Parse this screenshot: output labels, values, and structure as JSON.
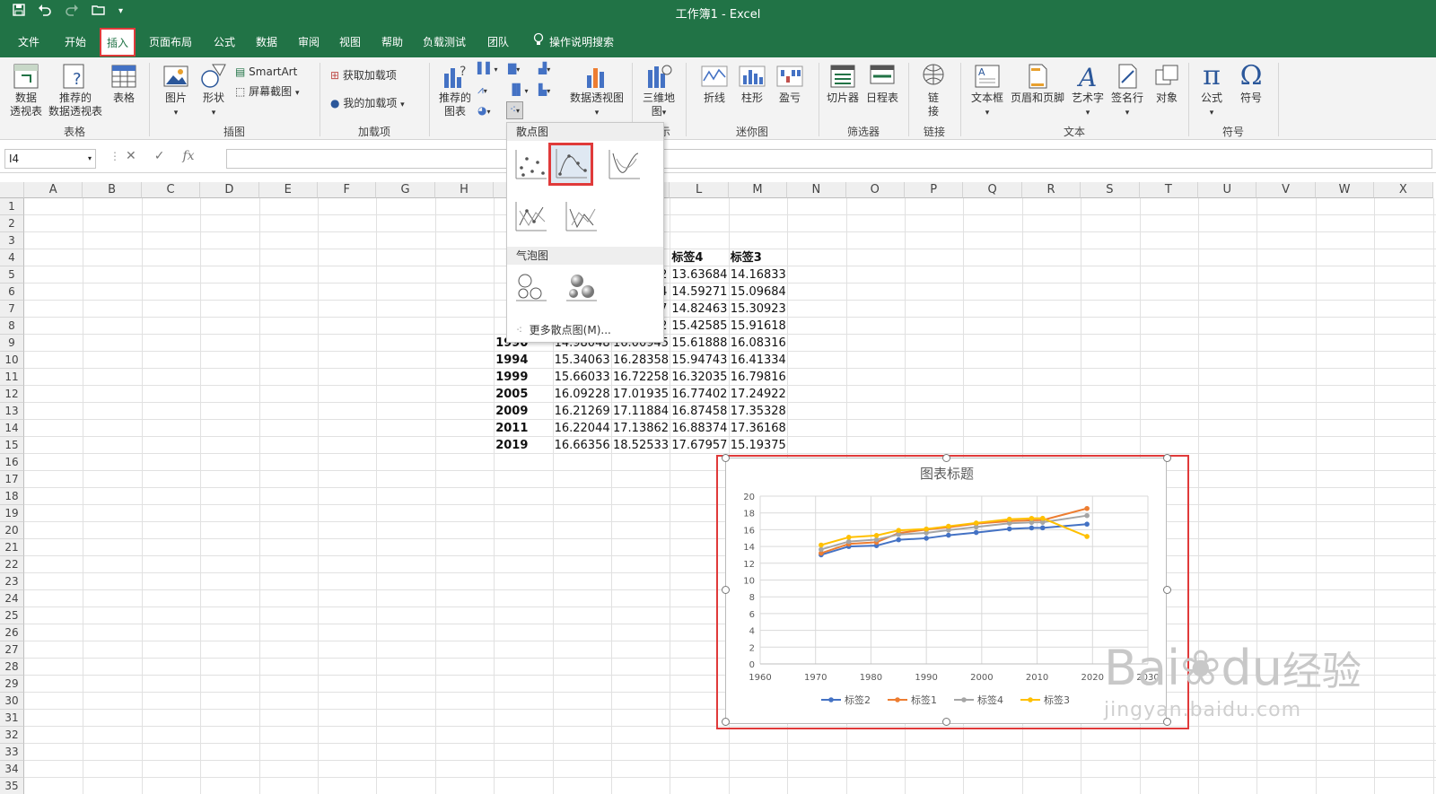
{
  "window": {
    "title": "工作簿1 - Excel",
    "accent": "#217346"
  },
  "qat": {
    "icons": [
      "save-icon",
      "undo-icon",
      "redo-icon",
      "open-icon",
      "customize-icon"
    ]
  },
  "tabs": [
    "文件",
    "开始",
    "插入",
    "页面布局",
    "公式",
    "数据",
    "审阅",
    "视图",
    "帮助",
    "负载测试",
    "团队"
  ],
  "active_tab": "插入",
  "tell_me": "操作说明搜索",
  "ribbon": {
    "groups": [
      "表格",
      "插图",
      "加载项",
      "图表",
      "迷你图",
      "筛选器",
      "链接",
      "文本",
      "符号"
    ],
    "charts_group_partial": "示",
    "tables": [
      {
        "label1": "数据",
        "label2": "透视表"
      },
      {
        "label1": "推荐的",
        "label2": "数据透视表"
      },
      {
        "label1": "表格",
        "label2": ""
      }
    ],
    "illustrations": {
      "picture": "图片",
      "shape": "形状",
      "smartart": "SmartArt",
      "screenshot": "屏幕截图"
    },
    "addins": {
      "get": "获取加载项",
      "mine": "我的加载项"
    },
    "charts": {
      "recommended1": "推荐的",
      "recommended2": "图表",
      "pivotchart": "数据透视图",
      "map1": "三维地",
      "map2": "图"
    },
    "sparklines": [
      "折线",
      "柱形",
      "盈亏"
    ],
    "filters": [
      "切片器",
      "日程表"
    ],
    "links": {
      "l1": "链",
      "l2": "接"
    },
    "text": [
      "文本框",
      "页眉和页脚",
      "艺术字",
      "签名行",
      "对象"
    ],
    "symbols": [
      "公式",
      "符号"
    ]
  },
  "formula_bar": {
    "name_box": "I4",
    "fx": "fx",
    "cancel": "✕",
    "enter": "✓",
    "value": ""
  },
  "columns": [
    "A",
    "B",
    "C",
    "D",
    "E",
    "F",
    "G",
    "H",
    "I",
    "J",
    "K",
    "L",
    "M",
    "N",
    "O",
    "P",
    "Q",
    "R",
    "S",
    "T",
    "U",
    "V",
    "W",
    "X"
  ],
  "rows": [
    "1",
    "2",
    "3",
    "4",
    "5",
    "6",
    "7",
    "8",
    "9",
    "10",
    "11",
    "12",
    "13",
    "14",
    "15",
    "16",
    "17",
    "18",
    "19",
    "20",
    "21",
    "22",
    "23",
    "24",
    "25",
    "26",
    "27",
    "28",
    "29",
    "30",
    "31",
    "32",
    "33",
    "34",
    "35"
  ],
  "sheet": {
    "headers_visible": [
      "标签4",
      "标签3"
    ],
    "partial_rows": [
      {
        "k": "2",
        "l": "13.63684",
        "m": "14.16833"
      },
      {
        "k": "4",
        "l": "14.59271",
        "m": "15.09684"
      },
      {
        "k": "7",
        "l": "14.82463",
        "m": "15.30923"
      },
      {
        "k": "2",
        "l": "15.42585",
        "m": "15.91618"
      }
    ],
    "row9": {
      "i": "1990",
      "j": "14.98048",
      "k": "16.00945",
      "l": "15.61888",
      "m": "16.08316"
    },
    "full_rows": [
      {
        "i": "1994",
        "j": "15.34063",
        "k": "16.28358",
        "l": "15.94743",
        "m": "16.41334"
      },
      {
        "i": "1999",
        "j": "15.66033",
        "k": "16.72258",
        "l": "16.32035",
        "m": "16.79816"
      },
      {
        "i": "2005",
        "j": "16.09228",
        "k": "17.01935",
        "l": "16.77402",
        "m": "17.24922"
      },
      {
        "i": "2009",
        "j": "16.21269",
        "k": "17.11884",
        "l": "16.87458",
        "m": "17.35328"
      },
      {
        "i": "2011",
        "j": "16.22044",
        "k": "17.13862",
        "l": "16.88374",
        "m": "17.36168"
      },
      {
        "i": "2019",
        "j": "16.66356",
        "k": "18.52533",
        "l": "17.67957",
        "m": "15.19375"
      }
    ]
  },
  "dropdown": {
    "scatter_section": "散点图",
    "bubble_section": "气泡图",
    "more": "更多散点图(M)...",
    "selected": "scatter-smooth-lines-markers"
  },
  "chart_data": {
    "type": "scatter",
    "title": "图表标题",
    "xlim": [
      1960,
      2030
    ],
    "ylim": [
      0,
      20
    ],
    "xticks": [
      1960,
      1970,
      1980,
      1990,
      2000,
      2010,
      2020,
      2030
    ],
    "yticks": [
      0,
      2,
      4,
      6,
      8,
      10,
      12,
      14,
      16,
      18,
      20
    ],
    "grid": true,
    "legend_position": "bottom",
    "x": [
      1971,
      1976,
      1981,
      1985,
      1990,
      1994,
      1999,
      2005,
      2009,
      2011,
      2019
    ],
    "series": [
      {
        "name": "标签2",
        "color": "#4472c4",
        "values": [
          13.0,
          14.0,
          14.1,
          14.8,
          14.98,
          15.34,
          15.66,
          16.09,
          16.21,
          16.22,
          16.66
        ]
      },
      {
        "name": "标签1",
        "color": "#ed7d31",
        "values": [
          13.2,
          14.3,
          14.5,
          15.6,
          16.01,
          16.28,
          16.72,
          17.02,
          17.12,
          17.14,
          18.53
        ]
      },
      {
        "name": "标签4",
        "color": "#a5a5a5",
        "values": [
          13.64,
          14.59,
          14.82,
          15.43,
          15.62,
          15.95,
          16.32,
          16.77,
          16.87,
          16.88,
          17.68
        ]
      },
      {
        "name": "标签3",
        "color": "#ffc000",
        "values": [
          14.17,
          15.1,
          15.31,
          15.92,
          16.08,
          16.41,
          16.8,
          17.25,
          17.35,
          17.36,
          15.19
        ]
      }
    ]
  },
  "watermark": {
    "brand": "Bai",
    "du": "du",
    "jy": "经验",
    "url": "jingyan.baidu.com"
  }
}
